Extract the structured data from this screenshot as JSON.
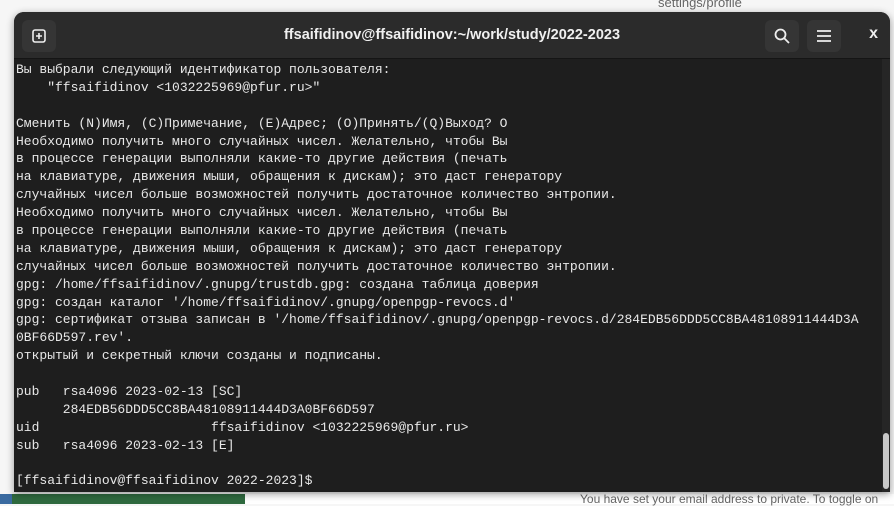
{
  "background": {
    "top_text": "settings/profile",
    "bottom_text": "You have set your email address to private. To toggle on"
  },
  "window": {
    "title": "ffsaifidinov@ffsaifidinov:~/work/study/2022-2023",
    "close_label": "x"
  },
  "terminal": {
    "lines": [
      "Вы выбрали следующий идентификатор пользователя:",
      "    \"ffsaifidinov <1032225969@pfur.ru>\"",
      "",
      "Сменить (N)Имя, (C)Примечание, (E)Адрес; (O)Принять/(Q)Выход? O",
      "Необходимо получить много случайных чисел. Желательно, чтобы Вы",
      "в процессе генерации выполняли какие-то другие действия (печать",
      "на клавиатуре, движения мыши, обращения к дискам); это даст генератору",
      "случайных чисел больше возможностей получить достаточное количество энтропии.",
      "Необходимо получить много случайных чисел. Желательно, чтобы Вы",
      "в процессе генерации выполняли какие-то другие действия (печать",
      "на клавиатуре, движения мыши, обращения к дискам); это даст генератору",
      "случайных чисел больше возможностей получить достаточное количество энтропии.",
      "gpg: /home/ffsaifidinov/.gnupg/trustdb.gpg: создана таблица доверия",
      "gpg: создан каталог '/home/ffsaifidinov/.gnupg/openpgp-revocs.d'",
      "gpg: сертификат отзыва записан в '/home/ffsaifidinov/.gnupg/openpgp-revocs.d/284EDB56DDD5CC8BA48108911444D3A",
      "0BF66D597.rev'.",
      "открытый и секретный ключи созданы и подписаны.",
      "",
      "pub   rsa4096 2023-02-13 [SC]",
      "      284EDB56DDD5CC8BA48108911444D3A0BF66D597",
      "uid                      ffsaifidinov <1032225969@pfur.ru>",
      "sub   rsa4096 2023-02-13 [E]",
      "",
      "[ffsaifidinov@ffsaifidinov 2022-2023]$ "
    ]
  }
}
